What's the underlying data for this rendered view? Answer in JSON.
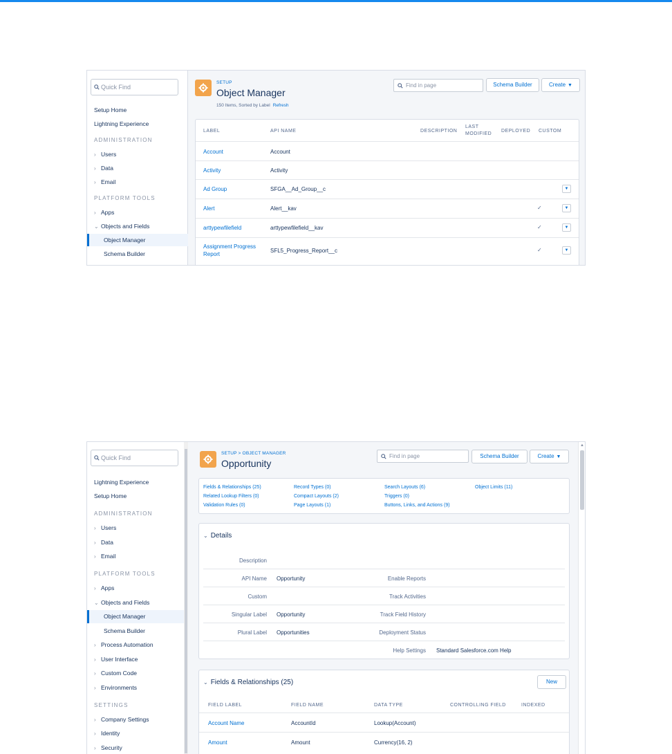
{
  "shot1": {
    "quick_find": "Quick Find",
    "nav": [
      {
        "label": "Setup Home"
      },
      {
        "label": "Lightning Experience"
      },
      {
        "label": "ADMINISTRATION"
      },
      {
        "label": "Users"
      },
      {
        "label": "Data"
      },
      {
        "label": "Email"
      },
      {
        "label": "PLATFORM TOOLS"
      },
      {
        "label": "Apps"
      },
      {
        "label": "Objects and Fields"
      },
      {
        "label": "Object Manager"
      },
      {
        "label": "Schema Builder"
      }
    ],
    "breadcrumb": "SETUP",
    "title": "Object Manager",
    "subtitle": "150 Items, Sorted by Label",
    "refresh": "Refresh",
    "find_placeholder": "Find in page",
    "schema_builder": "Schema Builder",
    "create": "Create",
    "columns": [
      "LABEL",
      "API NAME",
      "DESCRIPTION",
      "LAST",
      "MODIFIED",
      "DEPLOYED",
      "CUSTOM"
    ],
    "rows": [
      {
        "label": "Account",
        "api": "Account",
        "custom": "",
        "menu": false
      },
      {
        "label": "Activity",
        "api": "Activity",
        "custom": "",
        "menu": false
      },
      {
        "label": "Ad Group",
        "api": "SFGA__Ad_Group__c",
        "custom": "",
        "menu": true
      },
      {
        "label": "Alert",
        "api": "Alert__kav",
        "custom": "✓",
        "menu": true
      },
      {
        "label": "arttypewfilefield",
        "api": "arttypewfilefield__kav",
        "custom": "✓",
        "menu": true
      },
      {
        "label": "Assignment Progress",
        "label2": "Report",
        "api": "SFL5_Progress_Report__c",
        "custom": "✓",
        "menu": true
      }
    ]
  },
  "shot2": {
    "quick_find": "Quick Find",
    "nav": [
      {
        "label": "Lightning Experience"
      },
      {
        "label": "Setup Home"
      },
      {
        "label": "ADMINISTRATION"
      },
      {
        "label": "Users"
      },
      {
        "label": "Data"
      },
      {
        "label": "Email"
      },
      {
        "label": "PLATFORM TOOLS"
      },
      {
        "label": "Apps"
      },
      {
        "label": "Objects and Fields"
      },
      {
        "label": "Object Manager"
      },
      {
        "label": "Schema Builder"
      },
      {
        "label": "Process Automation"
      },
      {
        "label": "User Interface"
      },
      {
        "label": "Custom Code"
      },
      {
        "label": "Environments"
      },
      {
        "label": "SETTINGS"
      },
      {
        "label": "Company Settings"
      },
      {
        "label": "Identity"
      },
      {
        "label": "Security"
      }
    ],
    "breadcrumb": "SETUP > OBJECT MANAGER",
    "title": "Opportunity",
    "find_placeholder": "Find in page",
    "schema_builder": "Schema Builder",
    "create": "Create",
    "quick_links": [
      "Fields & Relationships (25)",
      "Record Types (0)",
      "Search Layouts (6)",
      "Object Limits (11)",
      "Related Lookup Filters (0)",
      "Compact Layouts (2)",
      "Triggers (0)",
      "Validation Rules (0)",
      "Page Layouts (1)",
      "Buttons, Links, and Actions (9)"
    ],
    "details_title": "Details",
    "details": {
      "description_label": "Description",
      "api_name_label": "API Name",
      "api_name": "Opportunity",
      "enable_reports_label": "Enable Reports",
      "custom_label": "Custom",
      "track_activities_label": "Track Activities",
      "singular_label_label": "Singular Label",
      "singular_label": "Opportunity",
      "track_field_history_label": "Track Field History",
      "plural_label_label": "Plural Label",
      "plural_label": "Opportunities",
      "deployment_status_label": "Deployment Status",
      "help_settings_label": "Help Settings",
      "help_settings": "Standard Salesforce.com Help"
    },
    "fields_title": "Fields & Relationships (25)",
    "new_button": "New",
    "field_columns": [
      "FIELD LABEL",
      "FIELD NAME",
      "DATA TYPE",
      "CONTROLLING FIELD",
      "INDEXED"
    ],
    "fields": [
      {
        "label": "Account Name",
        "name": "AccountId",
        "type": "Lookup(Account)"
      },
      {
        "label": "Amount",
        "name": "Amount",
        "type": "Currency(16, 2)"
      }
    ]
  },
  "colors": {
    "accent": "#0070d2",
    "topbar": "#1589ee",
    "setup_icon": "#f2a44c"
  }
}
